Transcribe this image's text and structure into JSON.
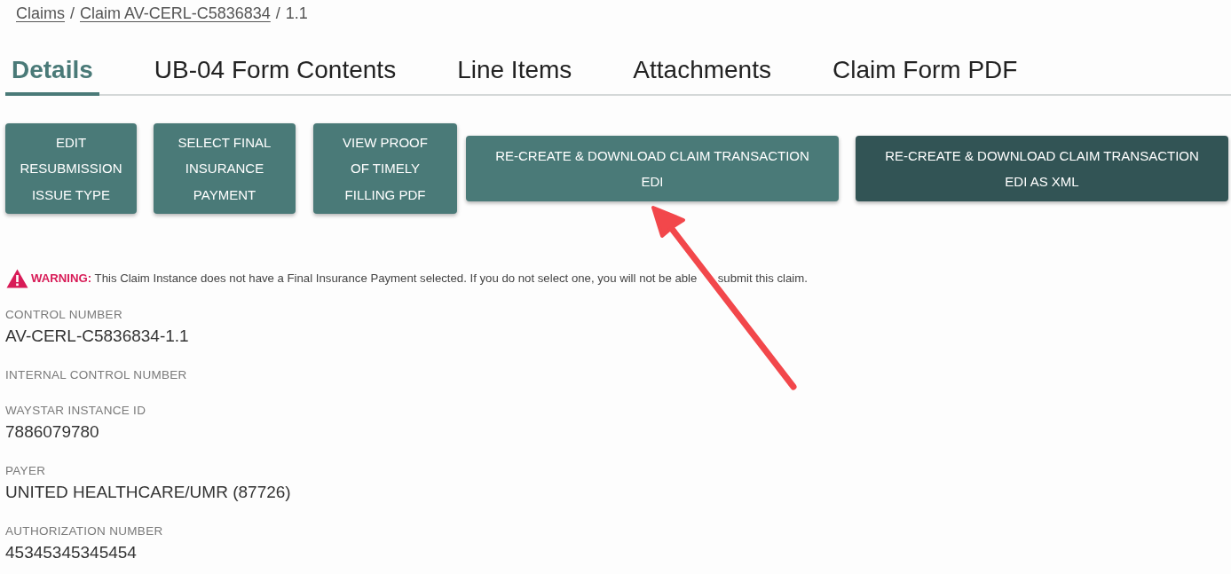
{
  "breadcrumb": [
    {
      "kind": "link",
      "text": "Claims"
    },
    {
      "kind": "separator",
      "text": "/"
    },
    {
      "kind": "link",
      "text": "Claim AV-CERL-C5836834"
    },
    {
      "kind": "separator",
      "text": "/"
    },
    {
      "kind": "current",
      "text": "1.1"
    }
  ],
  "tabs": [
    {
      "label": "Details",
      "selected": true
    },
    {
      "label": "UB-04 Form Contents",
      "selected": false
    },
    {
      "label": "Line Items",
      "selected": false
    },
    {
      "label": "Attachments",
      "selected": false
    },
    {
      "label": "Claim Form PDF",
      "selected": false
    }
  ],
  "actions": [
    {
      "label": "EDIT RESUBMISSION ISSUE TYPE",
      "kind": "primary"
    },
    {
      "label": "SELECT FINAL INSURANCE PAYMENT",
      "kind": "primary"
    },
    {
      "label": "VIEW PROOF OF TIMELY FILLING PDF",
      "kind": "primary"
    },
    {
      "label": "RE-CREATE & DOWNLOAD CLAIM TRANSACTION EDI",
      "kind": "primary"
    },
    {
      "label": "RE-CREATE & DOWNLOAD CLAIM TRANSACTION EDI AS XML",
      "kind": "dark"
    }
  ],
  "warning": {
    "label": "WARNING:",
    "text": "This Claim Instance does not have a Final Insurance Payment selected. If you do not select one, you will not be able",
    "text_after_arrow": "submit this claim."
  },
  "fields": [
    {
      "label": "CONTROL NUMBER",
      "value": "AV-CERL-C5836834-1.1"
    },
    {
      "label": "INTERNAL CONTROL NUMBER"
    },
    {
      "label": "WAYSTAR INSTANCE ID",
      "value": "7886079780"
    },
    {
      "label": "PAYER",
      "value": "UNITED HEALTHCARE/UMR (87726)"
    },
    {
      "label": "AUTHORIZATION NUMBER",
      "value": "45345345345454"
    }
  ]
}
